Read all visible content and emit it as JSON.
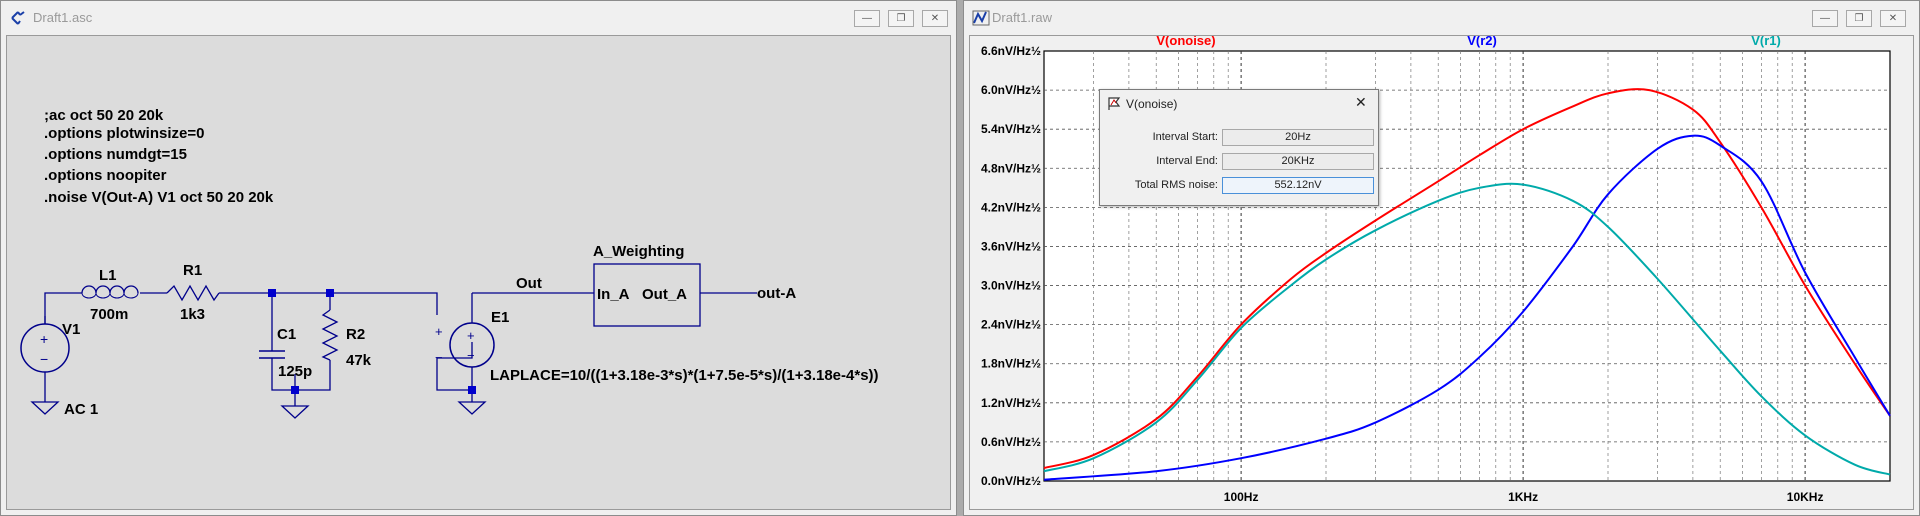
{
  "schematic": {
    "title": "Draft1.asc",
    "directives": [
      ";ac oct 50 20 20k",
      ".options plotwinsize=0",
      ".options numdgt=15",
      ".options noopiter",
      ".noise V(Out-A) V1 oct 50 20 20k"
    ],
    "labels": {
      "l1": "L1",
      "l1_value": "700m",
      "r1": "R1",
      "r1_value": "1k3",
      "c1": "C1",
      "c1_value": "125p",
      "r2": "R2",
      "r2_value": "47k",
      "v1": "V1",
      "v1_value": "AC 1",
      "e1": "E1",
      "net_out": "Out",
      "block_name": "A_Weighting",
      "block_in": "In_A",
      "block_out": "Out_A",
      "net_out_a": "out-A",
      "laplace": "LAPLACE=10/((1+3.18e-3*s)*(1+7.5e-5*s)/(1+3.18e-4*s))",
      "plus": "+",
      "minus": "−"
    }
  },
  "plot": {
    "title": "Draft1.raw",
    "colors": {
      "noise": "#ff0000",
      "r2": "#0000ff",
      "r1": "#00aaaa"
    },
    "chart_data": {
      "type": "line",
      "x_scale": "log",
      "xlim": [
        20,
        20000
      ],
      "ylim": [
        0,
        6.6
      ],
      "yunit": "nV/Hz½",
      "y_tick_labels": [
        "0.0nV/Hz½",
        "0.6nV/Hz½",
        "1.2nV/Hz½",
        "1.8nV/Hz½",
        "2.4nV/Hz½",
        "3.0nV/Hz½",
        "3.6nV/Hz½",
        "4.2nV/Hz½",
        "4.8nV/Hz½",
        "5.4nV/Hz½",
        "6.0nV/Hz½",
        "6.6nV/Hz½"
      ],
      "y_ticks": [
        0,
        0.6,
        1.2,
        1.8,
        2.4,
        3.0,
        3.6,
        4.2,
        4.8,
        5.4,
        6.0,
        6.6
      ],
      "x_tick_labels": [
        "100Hz",
        "1KHz",
        "10KHz"
      ],
      "x_ticks": [
        100,
        1000,
        10000
      ],
      "grid": true,
      "series": [
        {
          "name": "V(onoise)",
          "x": [
            20,
            30,
            50,
            70,
            100,
            150,
            200,
            300,
            500,
            700,
            1000,
            1500,
            2000,
            2800,
            4000,
            5000,
            7000,
            10000,
            15000,
            20000
          ],
          "y": [
            0.2,
            0.4,
            0.95,
            1.6,
            2.4,
            3.1,
            3.5,
            4.0,
            4.6,
            5.0,
            5.4,
            5.75,
            5.95,
            6.0,
            5.7,
            5.2,
            4.2,
            3.0,
            1.8,
            1.0
          ]
        },
        {
          "name": "V(r2)",
          "x": [
            20,
            50,
            100,
            200,
            300,
            500,
            700,
            1000,
            1500,
            2000,
            3000,
            4000,
            5000,
            7000,
            10000,
            15000,
            20000
          ],
          "y": [
            0.02,
            0.15,
            0.35,
            0.65,
            0.9,
            1.4,
            1.9,
            2.6,
            3.6,
            4.4,
            5.1,
            5.3,
            5.15,
            4.6,
            3.2,
            1.9,
            1.0
          ]
        },
        {
          "name": "V(r1)",
          "x": [
            20,
            30,
            50,
            70,
            100,
            150,
            200,
            300,
            500,
            700,
            1000,
            1500,
            2000,
            3000,
            5000,
            7000,
            10000,
            15000,
            20000
          ],
          "y": [
            0.15,
            0.35,
            0.9,
            1.55,
            2.35,
            3.0,
            3.4,
            3.85,
            4.3,
            4.5,
            4.55,
            4.3,
            3.9,
            3.1,
            2.0,
            1.3,
            0.7,
            0.25,
            0.1
          ]
        }
      ]
    },
    "dialog": {
      "title": "V(onoise)",
      "close": "✕",
      "rows": [
        {
          "label": "Interval Start:",
          "value": "20Hz"
        },
        {
          "label": "Interval End:",
          "value": "20KHz"
        },
        {
          "label": "Total RMS noise:",
          "value": "552.12nV"
        }
      ]
    }
  },
  "window_buttons": {
    "minimize": "—",
    "maximize": "❐",
    "close": "✕"
  }
}
